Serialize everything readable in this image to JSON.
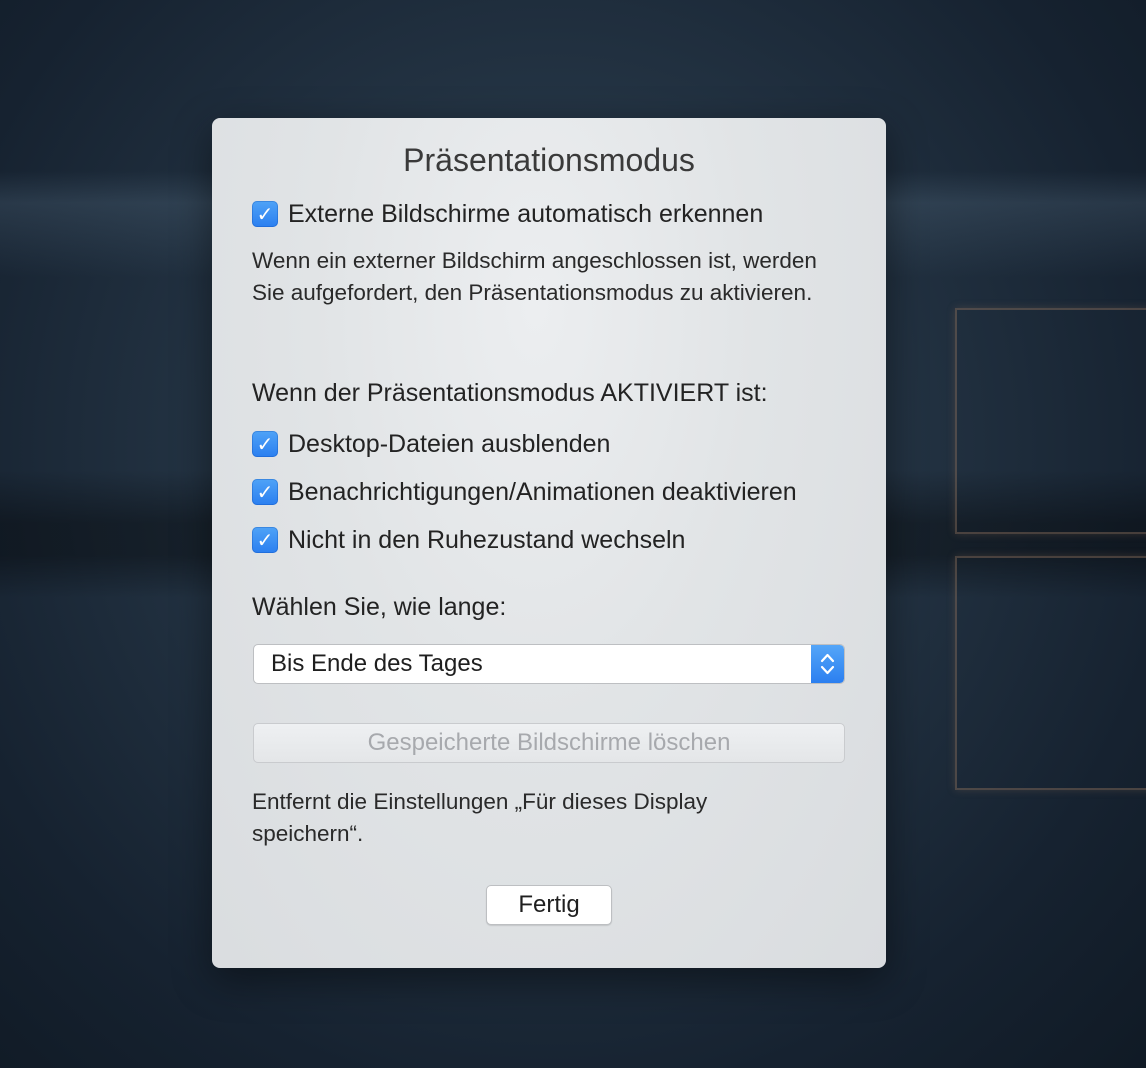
{
  "dialog": {
    "title": "Präsentationsmodus",
    "auto_detect": {
      "checked": true,
      "label": "Externe Bildschirme automatisch erkennen"
    },
    "auto_detect_description": "Wenn ein externer Bildschirm angeschlossen ist, werden Sie aufgefordert, den Präsentationsmodus zu aktivieren.",
    "when_active_heading": "Wenn der Präsentationsmodus AKTIVIERT ist:",
    "options": [
      {
        "checked": true,
        "label": "Desktop-Dateien ausblenden"
      },
      {
        "checked": true,
        "label": "Benachrichtigungen/Animationen deaktivieren"
      },
      {
        "checked": true,
        "label": "Nicht in den Ruhezustand wechseln"
      }
    ],
    "duration_heading": "Wählen Sie, wie lange:",
    "duration_select": {
      "selected": "Bis Ende des Tages"
    },
    "clear_button_label": "Gespeicherte Bildschirme löschen",
    "clear_description": "Entfernt die Einstellungen „Für dieses Display speichern“.",
    "done_button_label": "Fertig"
  },
  "colors": {
    "accent": "#2b7ff0",
    "dialog_background": "#e1e4e6",
    "desktop_background": "#1b2734"
  },
  "icons": {
    "checkmark": "checkmark-icon",
    "stepper": "chevron-updown-icon"
  }
}
